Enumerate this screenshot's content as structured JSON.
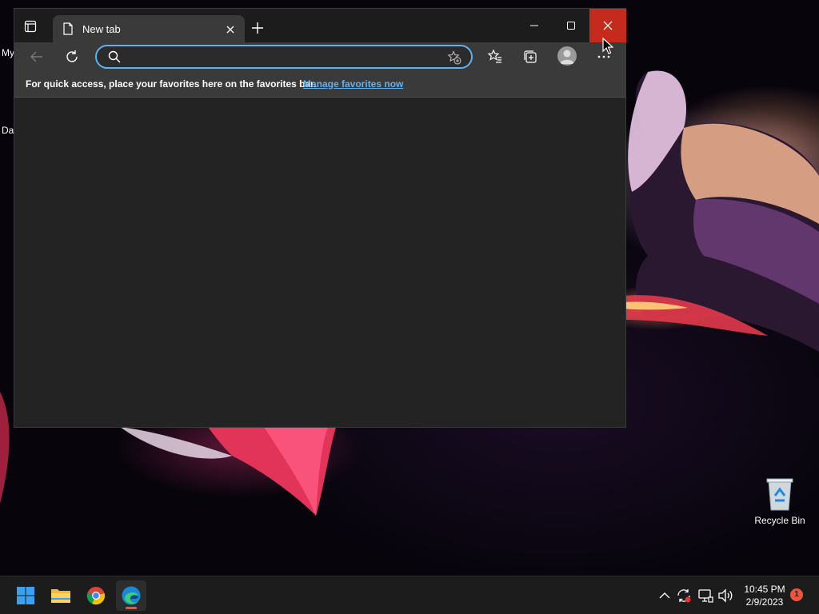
{
  "browser": {
    "tab": {
      "title": "New tab"
    },
    "address_bar": {
      "value": "",
      "placeholder": ""
    },
    "favorites_bar": {
      "message": "For quick access, place your favorites here on the favorites bar.",
      "link": "Manage favorites now"
    },
    "icons": {
      "tab_actions": "tab-actions-icon",
      "page": "page-icon",
      "tab_close": "close-icon",
      "new_tab": "plus-icon",
      "minimize": "minimize-icon",
      "maximize": "maximize-icon",
      "close": "close-icon",
      "back": "back-arrow-icon",
      "refresh": "refresh-icon",
      "search": "search-icon",
      "add_favorite": "star-plus-icon",
      "favorites": "favorites-icon",
      "collections": "collections-icon",
      "profile": "profile-icon",
      "more": "more-icon"
    }
  },
  "desktop": {
    "left_fragments": [
      "My",
      "Da"
    ],
    "recycle_bin_label": "Recycle Bin"
  },
  "taskbar": {
    "apps": [
      "start",
      "file-explorer",
      "chrome",
      "edge"
    ],
    "time": "10:45 PM",
    "date": "2/9/2023",
    "notification_count": "1"
  },
  "colors": {
    "accent": "#5fb2f2",
    "close_hover": "#c42b1c",
    "window_bg": "#232323",
    "toolbar_bg": "#3a3a3a",
    "taskbar_bg": "#1c1c1c"
  }
}
